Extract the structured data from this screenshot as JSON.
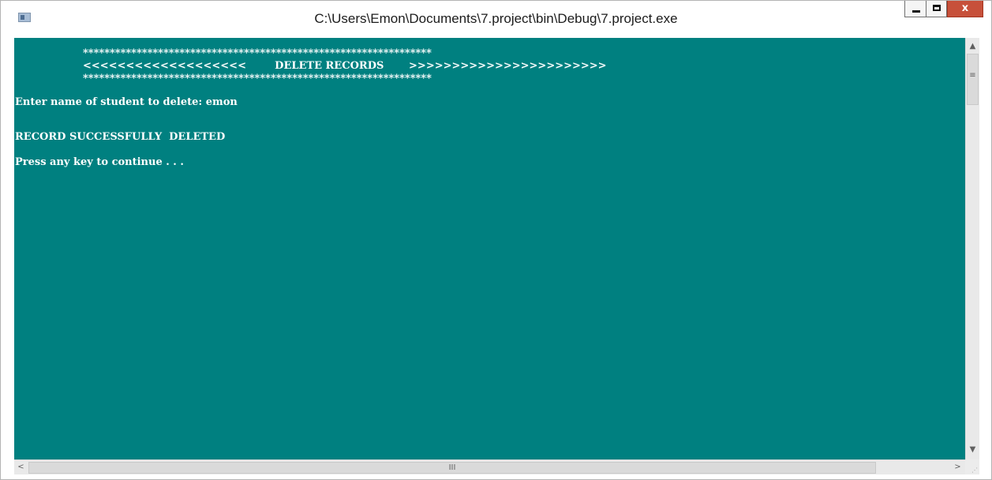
{
  "window": {
    "title": "C:\\Users\\Emon\\Documents\\7.project\\bin\\Debug\\7.project.exe",
    "icon": "console-app-icon",
    "controls": {
      "minimize_icon": "minimize-icon",
      "maximize_icon": "maximize-icon",
      "close_label": "x"
    }
  },
  "console": {
    "background_color": "#008080",
    "text_color": "#ffffff",
    "lines": {
      "banner_top": "*****************************************************************",
      "banner_middle": "<<<<<<<<<<<<<<<<<<<        DELETE RECORDS       >>>>>>>>>>>>>>>>>>>>>>>",
      "banner_bottom": "*****************************************************************",
      "prompt": "Enter name of student to delete: emon",
      "result": "RECORD SUCCESSFULLY  DELETED",
      "continue": "Press any key to continue . . ."
    }
  },
  "scrollbars": {
    "vertical": {
      "up_arrow": "▲",
      "down_arrow": "▼",
      "grip": "≡"
    },
    "horizontal": {
      "left_arrow": "<",
      "right_arrow": ">",
      "grip": "III"
    }
  },
  "colors": {
    "close_button": "#c7503a",
    "console_background": "#008080"
  }
}
